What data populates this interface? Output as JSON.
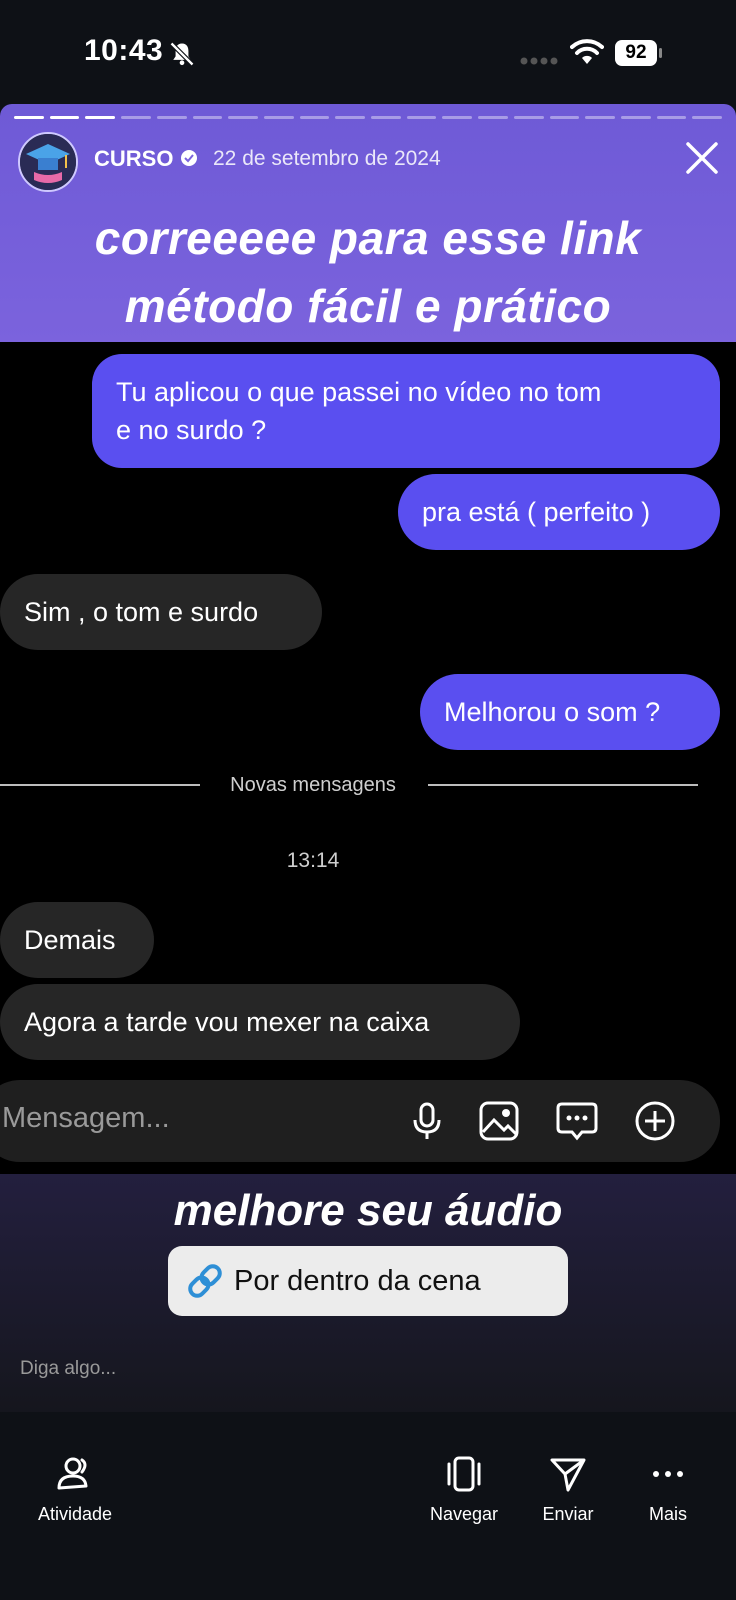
{
  "status_bar": {
    "time": "10:43",
    "battery": "92"
  },
  "story": {
    "username": "CURSO",
    "date": "22 de setembro de 2024",
    "headline_line1": "correeeee para esse link",
    "headline_line2": "método fácil e prático",
    "progress_segments_total": 20,
    "progress_segments_done": 3,
    "bottom_headline": "melhore seu áudio",
    "link_sticker": "Por dentro da cena",
    "reply_placeholder": "Diga algo..."
  },
  "chat": {
    "messages": [
      {
        "side": "out",
        "line1": "Tu aplicou o que passei no vídeo no tom",
        "line2": "e no surdo ?"
      },
      {
        "side": "out",
        "text": "pra está ( perfeito )"
      },
      {
        "side": "in",
        "text": "Sim , o tom e surdo"
      },
      {
        "side": "out",
        "text": "Melhorou o som ?"
      },
      {
        "side": "in",
        "text": "Demais"
      },
      {
        "side": "in",
        "text": "Agora a tarde vou mexer na caixa"
      }
    ],
    "divider_label": "Novas mensagens",
    "timestamp": "13:14",
    "composer_placeholder": "Mensagem..."
  },
  "bottom_nav": {
    "activity": "Atividade",
    "browse": "Navegar",
    "send": "Enviar",
    "more": "Mais"
  },
  "colors": {
    "story_header": "#7b63dd",
    "outgoing_bubble": "#5a4ff0",
    "incoming_bubble": "#262626",
    "link_icon": "#2e8fd6"
  }
}
